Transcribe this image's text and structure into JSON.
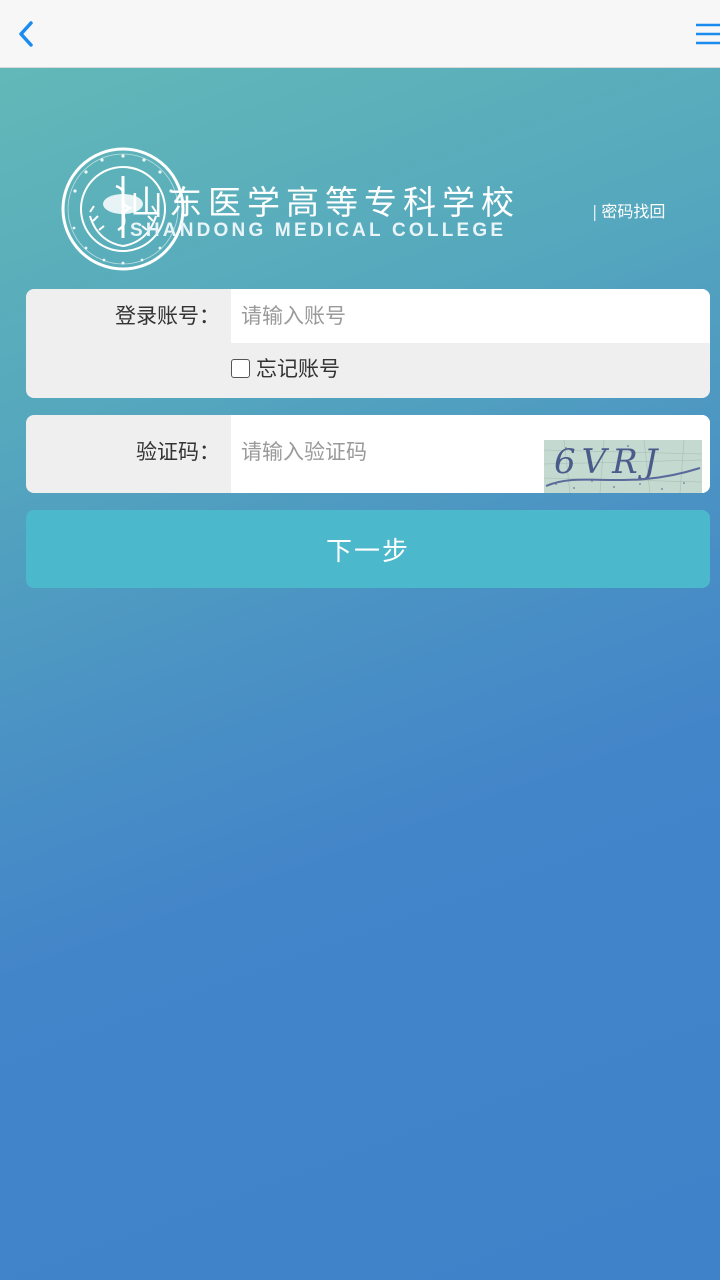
{
  "topbar": {
    "back_icon": "chevron-left-icon",
    "menu_icon": "hamburger-menu-icon",
    "accent_color": "#1a8cf0"
  },
  "header": {
    "school_name_cn": "山东医学高等专科学校",
    "school_name_en": "SHANDONG MEDICAL COLLEGE",
    "recover_separator": "|",
    "recover_link": "密码找回"
  },
  "account_form": {
    "label": "登录账号：",
    "placeholder": "请输入账号",
    "value": "",
    "remember_label": "忘记账号",
    "remember_checked": false
  },
  "captcha_form": {
    "label": "验证码：",
    "placeholder": "请输入验证码",
    "value": "",
    "captcha_text": "6VRJ"
  },
  "next_button": {
    "label": "下一步",
    "color": "#4bb8cc"
  }
}
